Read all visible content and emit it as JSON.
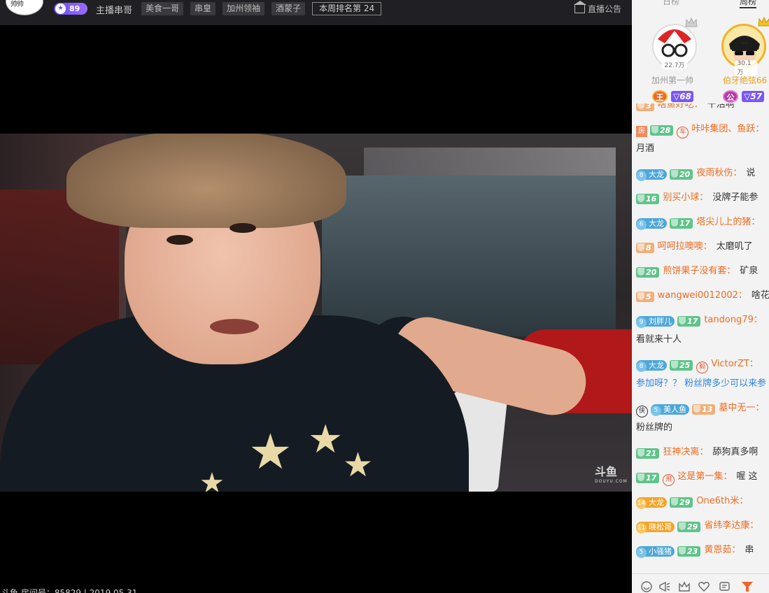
{
  "header": {
    "anchor_level": "89",
    "anchor_name": "主播串哥",
    "tags": [
      "美食一哥",
      "串皇",
      "加州领袖",
      "酒蒙子"
    ],
    "weekly_rank": "本周排名第 24",
    "notice": "直播公告"
  },
  "video": {
    "watermark": "斗鱼",
    "watermark_sub": "DOUYU.COM"
  },
  "footer_info": "斗鱼 房间号：85829 | 2019.05.31",
  "sidebar": {
    "rank_tabs": [
      "日榜",
      "周榜"
    ],
    "podium": [
      {
        "name": "加州第一帅",
        "score": "22.7万",
        "medal": "王",
        "level": "68"
      },
      {
        "name": "伯牙绝弦66",
        "score": "30.1万",
        "medal": "公",
        "level": "57"
      }
    ],
    "chat": [
      {
        "badges": [
          {
            "type": "lv",
            "color": "o",
            "v": "3"
          }
        ],
        "user": "啥鱼好吃",
        "text": "干活啊"
      },
      {
        "badges": [
          {
            "type": "sq",
            "v": "房"
          },
          {
            "type": "lv",
            "color": "g",
            "v": "28"
          },
          {
            "type": "round",
            "v": "车"
          }
        ],
        "user": "咔咔集团、鱼跃",
        "text": "",
        "cont": "月酒"
      },
      {
        "badges": [
          {
            "type": "fan",
            "color": "b",
            "n": "8",
            "v": "大龙"
          },
          {
            "type": "lv",
            "color": "g",
            "v": "20"
          }
        ],
        "user": "夜雨秋伤",
        "text": "说"
      },
      {
        "badges": [
          {
            "type": "lv",
            "color": "g",
            "v": "16"
          }
        ],
        "user": "别买小球",
        "text": "没牌子能参"
      },
      {
        "badges": [
          {
            "type": "fan",
            "color": "b",
            "n": "6",
            "v": "大龙"
          },
          {
            "type": "lv",
            "color": "g",
            "v": "17"
          }
        ],
        "user": "塔尖儿上的猪",
        "text": ""
      },
      {
        "badges": [
          {
            "type": "lv",
            "color": "o",
            "v": "8"
          }
        ],
        "user": "呵呵拉噢噢",
        "text": "太磨叽了"
      },
      {
        "badges": [
          {
            "type": "lv",
            "color": "g",
            "v": "20"
          }
        ],
        "user": "煎饼果子没有套",
        "text": "矿泉"
      },
      {
        "badges": [
          {
            "type": "lv",
            "color": "o",
            "v": "5"
          }
        ],
        "user": "wangwei0012002",
        "text": "啥花"
      },
      {
        "badges": [
          {
            "type": "fan",
            "color": "b",
            "n": "9",
            "v": "刘胖儿"
          },
          {
            "type": "lv",
            "color": "g",
            "v": "17"
          }
        ],
        "user": "tandong79",
        "text": "",
        "cont": "看就来十人"
      },
      {
        "badges": [
          {
            "type": "fan",
            "color": "b",
            "n": "8",
            "v": "大龙"
          },
          {
            "type": "lv",
            "color": "g",
            "v": "25"
          },
          {
            "type": "round",
            "v": "毅"
          }
        ],
        "user": "VictorZT",
        "text": "",
        "cont": "参加呀？？ 粉丝牌多少可以来参"
      },
      {
        "badges": [
          {
            "type": "round_dark",
            "v": "侠"
          },
          {
            "type": "fan",
            "color": "b",
            "n": "5",
            "v": "美人鱼"
          },
          {
            "type": "lv",
            "color": "o",
            "v": "13"
          }
        ],
        "user": "墓中无一",
        "text": "",
        "cont": "粉丝牌的"
      },
      {
        "badges": [
          {
            "type": "lv",
            "color": "g",
            "v": "21"
          }
        ],
        "user": "狂神决离",
        "text": "舔狗真多啊"
      },
      {
        "badges": [
          {
            "type": "lv",
            "color": "g",
            "v": "17"
          },
          {
            "type": "round",
            "v": "飛"
          }
        ],
        "user": "这是第一集",
        "text": "喔 这"
      },
      {
        "badges": [
          {
            "type": "fan",
            "color": "y",
            "n": "14",
            "v": "大龙"
          },
          {
            "type": "lv",
            "color": "g",
            "v": "29"
          }
        ],
        "user": "One6th米",
        "text": ""
      },
      {
        "badges": [
          {
            "type": "fan",
            "color": "y",
            "n": "11",
            "v": "晓松哥"
          },
          {
            "type": "lv",
            "color": "g",
            "v": "29"
          }
        ],
        "user": "省纬李达康",
        "text": ""
      },
      {
        "badges": [
          {
            "type": "fan",
            "color": "b",
            "n": "5",
            "v": "小骚猪"
          },
          {
            "type": "lv",
            "color": "g",
            "v": "23"
          }
        ],
        "user": "黄恩茹",
        "text": "串"
      }
    ],
    "toolbar_icons": [
      "emoji-icon",
      "megaphone-icon",
      "crown-icon",
      "heart-icon",
      "message-icon",
      "filter-icon"
    ]
  },
  "colors": {
    "username": "#f06a1c",
    "level_green": "#5fc48a",
    "level_orange": "#efb07a",
    "fan_blue": "#4da7d9",
    "fan_gold": "#f2a52a",
    "accent_purple": "#7a57f7"
  }
}
